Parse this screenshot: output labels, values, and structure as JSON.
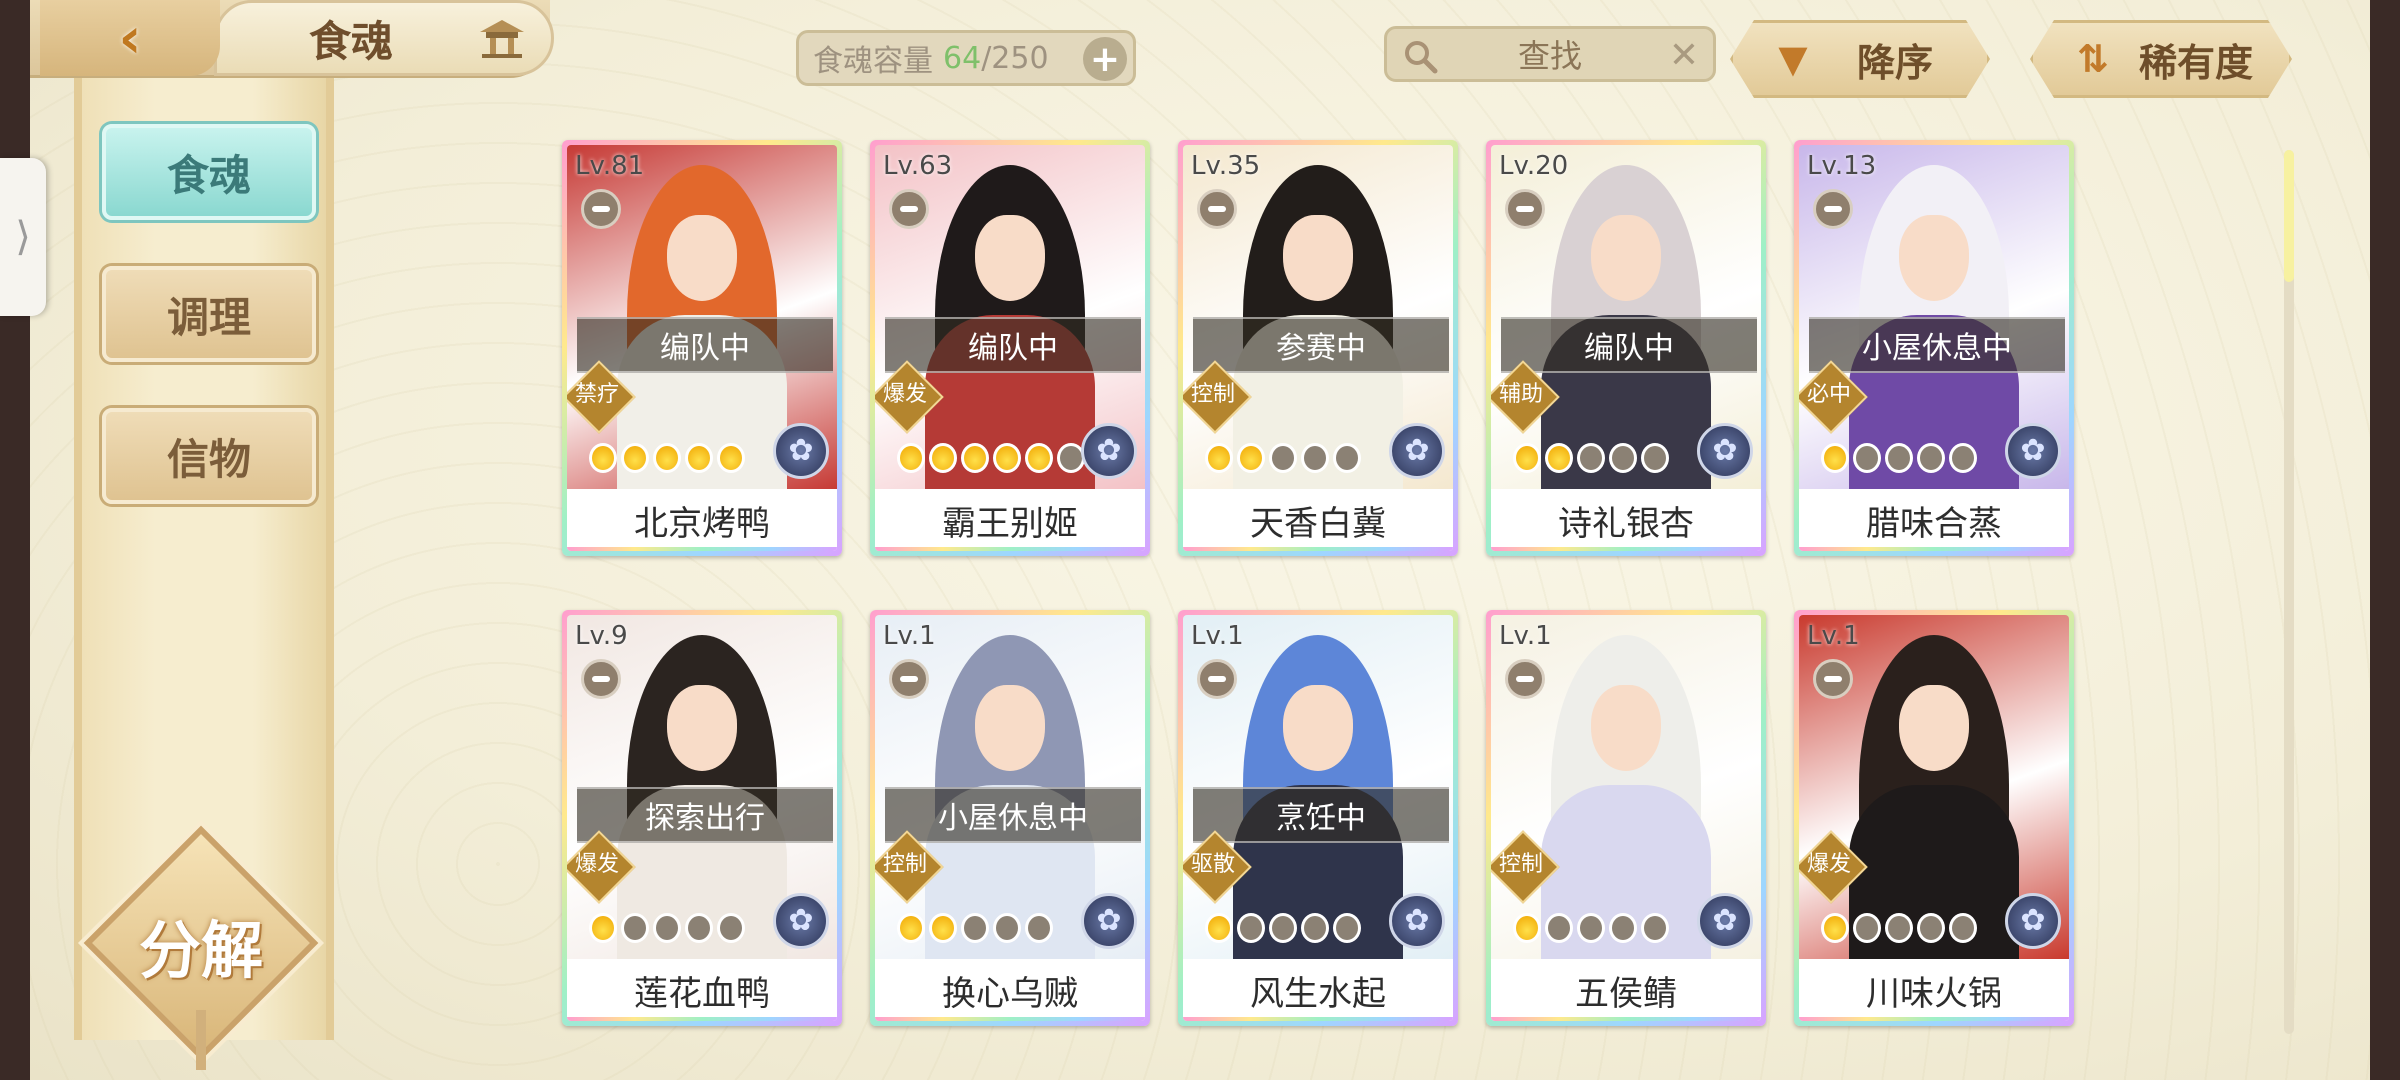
{
  "header": {
    "page_title": "食魂",
    "capacity_label": "食魂容量",
    "capacity_current": "64",
    "capacity_max": "/250",
    "search_placeholder": "查找",
    "sort_order_label": "降序",
    "sort_key_label": "稀有度"
  },
  "sidebar": {
    "tabs": [
      {
        "label": "食魂",
        "active": true
      },
      {
        "label": "调理",
        "active": false
      },
      {
        "label": "信物",
        "active": false
      }
    ],
    "decompose_label": "分解"
  },
  "cards": [
    {
      "level": "Lv.81",
      "status": "编队中",
      "role": "禁疗",
      "name": "北京烤鸭",
      "stars": 5,
      "stars_total": 5,
      "hair": "#e2682c",
      "bg": "#c63a35",
      "body": "#f1efe8"
    },
    {
      "level": "Lv.63",
      "status": "编队中",
      "role": "爆发",
      "name": "霸王别姬",
      "stars": 5,
      "stars_total": 6,
      "hair": "#1f1a1a",
      "bg": "#f3c2c6",
      "body": "#b53a36"
    },
    {
      "level": "Lv.35",
      "status": "参赛中",
      "role": "控制",
      "name": "天香白冀",
      "stars": 2,
      "stars_total": 5,
      "hair": "#221d1a",
      "bg": "#f4e8cf",
      "body": "#f2f0e4"
    },
    {
      "level": "Lv.20",
      "status": "编队中",
      "role": "辅助",
      "name": "诗礼银杏",
      "stars": 2,
      "stars_total": 5,
      "hair": "#d9d1d3",
      "bg": "#f4efd8",
      "body": "#3a3848"
    },
    {
      "level": "Lv.13",
      "status": "小屋休息中",
      "role": "必中",
      "name": "腊味合蒸",
      "stars": 1,
      "stars_total": 5,
      "hair": "#f2f0f6",
      "bg": "#c8b7ea",
      "body": "#6f4aa6"
    },
    {
      "level": "Lv.9",
      "status": "探索出行",
      "role": "爆发",
      "name": "莲花血鸭",
      "stars": 1,
      "stars_total": 5,
      "hair": "#2b2420",
      "bg": "#f1e7e2",
      "body": "#efe9e2"
    },
    {
      "level": "Lv.1",
      "status": "小屋休息中",
      "role": "控制",
      "name": "换心乌贼",
      "stars": 2,
      "stars_total": 5,
      "hair": "#8f97b4",
      "bg": "#e7eef5",
      "body": "#dfe6f2"
    },
    {
      "level": "Lv.1",
      "status": "烹饪中",
      "role": "驱散",
      "name": "风生水起",
      "stars": 1,
      "stars_total": 5,
      "hair": "#5d86d8",
      "bg": "#e2eff5",
      "body": "#2f344b"
    },
    {
      "level": "Lv.1",
      "status": "",
      "role": "控制",
      "name": "五侯鲭",
      "stars": 1,
      "stars_total": 5,
      "hair": "#eeeeea",
      "bg": "#f5f1e2",
      "body": "#d9d8ef"
    },
    {
      "level": "Lv.1",
      "status": "",
      "role": "爆发",
      "name": "川味火锅",
      "stars": 1,
      "stars_total": 5,
      "hair": "#2a201c",
      "bg": "#c93a2e",
      "body": "#1e1a1a"
    }
  ],
  "colors": {
    "accent_teal": "#8ad8d0",
    "gold": "#d6b57c",
    "capacity_green": "#7fc06a"
  }
}
